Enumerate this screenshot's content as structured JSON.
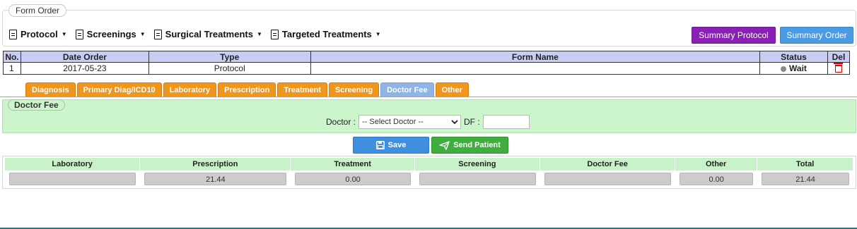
{
  "form_order": {
    "legend": "Form Order",
    "menu": [
      {
        "label": "Protocol"
      },
      {
        "label": "Screenings"
      },
      {
        "label": "Surgical Treatments"
      },
      {
        "label": "Targeted Treatments"
      }
    ],
    "summary_protocol_label": "Summary Protocol",
    "summary_order_label": "Summary Order"
  },
  "order_table": {
    "headers": [
      "No.",
      "Date Order",
      "Type",
      "Form Name",
      "Status",
      "Del"
    ],
    "rows": [
      {
        "no": "1",
        "date": "2017-05-23",
        "type": "Protocol",
        "form_name": "",
        "status": "Wait"
      }
    ]
  },
  "tabs": [
    {
      "label": "Diagnosis"
    },
    {
      "label": "Primary Diag/ICD10"
    },
    {
      "label": "Laboratory"
    },
    {
      "label": "Prescription"
    },
    {
      "label": "Treatment"
    },
    {
      "label": "Screening"
    },
    {
      "label": "Doctor Fee"
    },
    {
      "label": "Other"
    }
  ],
  "active_tab": "Doctor Fee",
  "doctor_fee": {
    "legend": "Doctor Fee",
    "doctor_label": "Doctor :",
    "doctor_select_value": "-- Select Doctor --",
    "df_label": "DF :",
    "df_value": ""
  },
  "actions": {
    "save_label": "Save",
    "send_label": "Send Patient"
  },
  "summary": {
    "headers": [
      "Laboratory",
      "Prescription",
      "Treatment",
      "Screening",
      "Doctor Fee",
      "Other",
      "Total"
    ],
    "values": [
      "",
      "21.44",
      "0.00",
      "",
      "",
      "0.00",
      "21.44"
    ]
  },
  "colors": {
    "tab_orange": "#f0961e",
    "tab_active": "#8fb4e6",
    "panel_green": "#ccf5cc",
    "summary_protocol_purple": "#8a1fb4",
    "summary_order_blue": "#4b9be3",
    "save_blue": "#3f8fe0",
    "send_green": "#3fae3f",
    "table_header": "#c9cdf3"
  },
  "icons": {
    "menu": "document-icon",
    "status": "status-dot-icon",
    "delete": "trash-icon",
    "save": "floppy-disk-icon",
    "send": "paper-plane-icon"
  }
}
